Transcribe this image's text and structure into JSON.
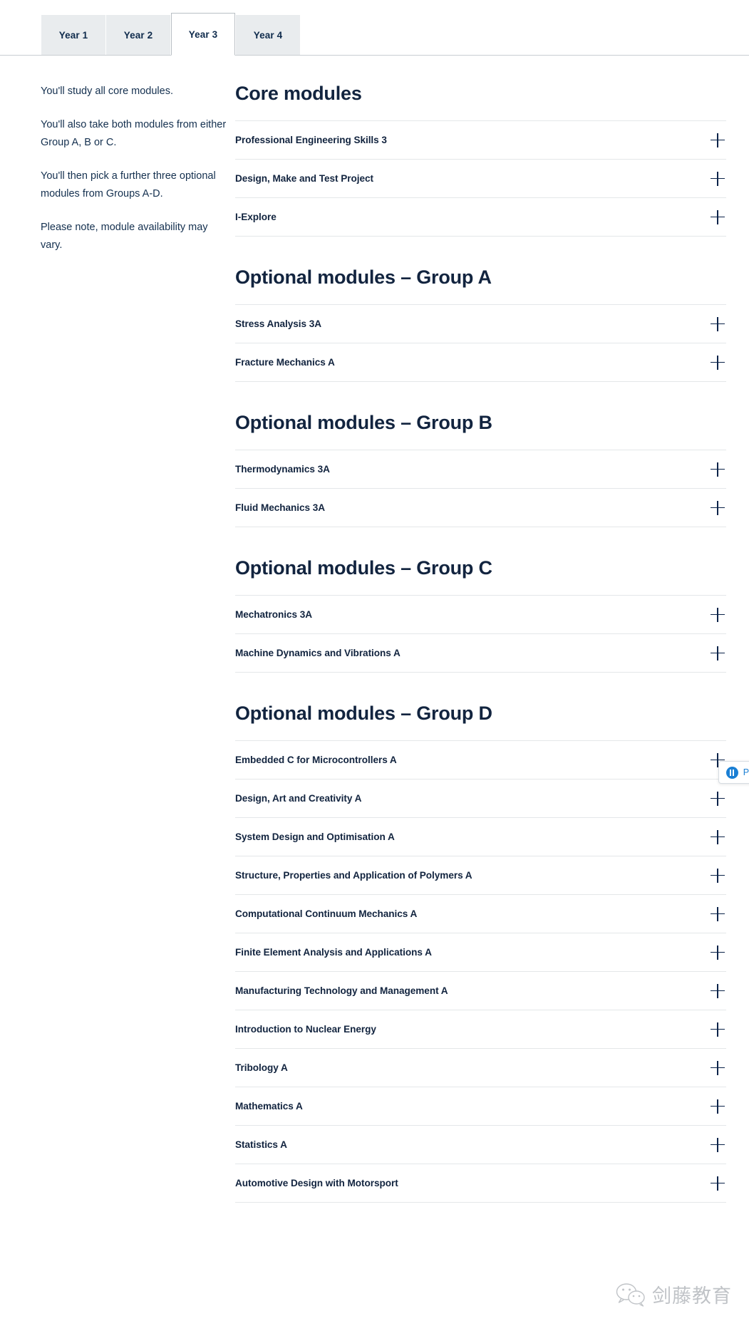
{
  "tabs": [
    {
      "label": "Year 1",
      "active": false
    },
    {
      "label": "Year 2",
      "active": false
    },
    {
      "label": "Year 3",
      "active": true
    },
    {
      "label": "Year 4",
      "active": false
    }
  ],
  "sidebar": {
    "paragraphs": [
      "You'll study all core modules.",
      "You'll also take both modules from either Group A, B or C.",
      "You'll then pick a further three optional modules from Groups A-D.",
      "Please note, module availability may vary."
    ]
  },
  "main": {
    "sections": [
      {
        "title": "Core modules",
        "modules": [
          "Professional Engineering Skills 3",
          "Design, Make and Test Project",
          "I-Explore"
        ]
      },
      {
        "title": "Optional modules – Group A",
        "modules": [
          "Stress Analysis 3A",
          "Fracture Mechanics A"
        ]
      },
      {
        "title": "Optional modules – Group B",
        "modules": [
          "Thermodynamics 3A",
          "Fluid Mechanics 3A"
        ]
      },
      {
        "title": "Optional modules – Group C",
        "modules": [
          "Mechatronics 3A",
          "Machine Dynamics and Vibrations A"
        ]
      },
      {
        "title": "Optional modules – Group D",
        "modules": [
          "Embedded C for Microcontrollers A",
          "Design, Art and Creativity A",
          "System Design and Optimisation A",
          "Structure, Properties and Application of Polymers A",
          "Computational Continuum Mechanics A",
          "Finite Element Analysis and Applications A",
          "Manufacturing Technology and Management A",
          "Introduction to Nuclear Energy",
          "Tribology A",
          "Mathematics A",
          "Statistics A",
          "Automotive Design with Motorsport"
        ]
      }
    ],
    "expand_icon": "plus-icon"
  },
  "pause_widget": {
    "label": "Pa",
    "icon": "pause-icon"
  },
  "watermark": {
    "icon": "wechat-icon",
    "text": "剑藤教育"
  },
  "colors": {
    "text_navy": "#12243f",
    "tab_inactive_bg": "#e9ecee",
    "divider": "#e4e7e9",
    "accent_blue": "#1a7fd4"
  }
}
